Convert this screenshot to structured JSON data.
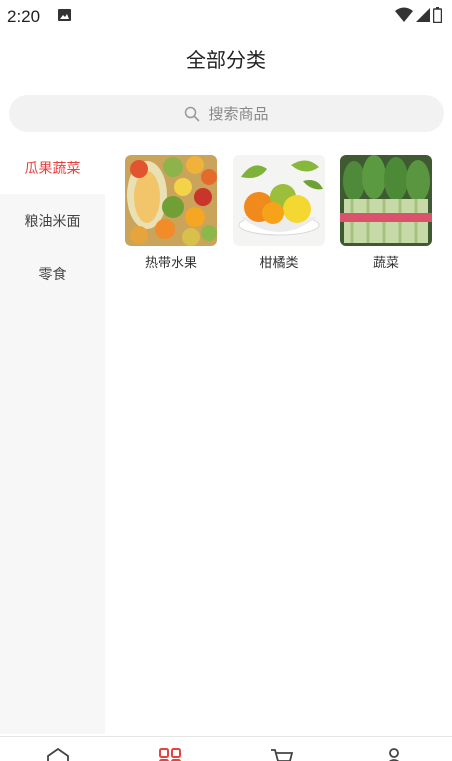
{
  "status_bar": {
    "time": "2:20",
    "icons": [
      "image-icon",
      "wifi-icon",
      "signal-icon",
      "battery-icon"
    ]
  },
  "header": {
    "title": "全部分类"
  },
  "search": {
    "placeholder": "搜索商品"
  },
  "sidebar": {
    "items": [
      {
        "label": "瓜果蔬菜",
        "active": true
      },
      {
        "label": "粮油米面",
        "active": false
      },
      {
        "label": "零食",
        "active": false
      }
    ]
  },
  "categories": [
    {
      "label": "热带水果",
      "image": "tropical-fruits"
    },
    {
      "label": "柑橘类",
      "image": "citrus-fruits"
    },
    {
      "label": "蔬菜",
      "image": "vegetables"
    }
  ],
  "tab_bar": {
    "icons": [
      "home-icon",
      "category-icon",
      "cart-icon",
      "profile-icon"
    ],
    "active_color": "#e64340"
  },
  "colors": {
    "accent": "#e64340",
    "sidebar_bg": "#f7f7f7",
    "search_bg": "#f2f2f2"
  }
}
